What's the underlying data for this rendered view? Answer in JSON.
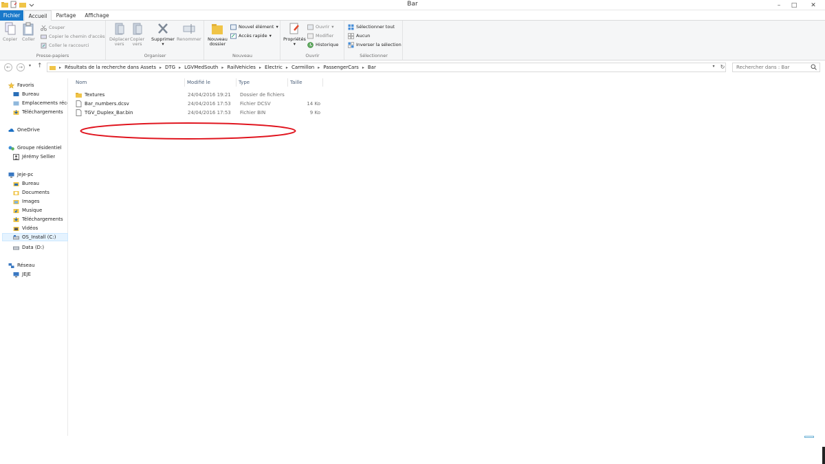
{
  "window": {
    "title": "Bar"
  },
  "tabs": [
    "Fichier",
    "Accueil",
    "Partage",
    "Affichage"
  ],
  "ribbon": {
    "clipboard": {
      "label": "Presse-papiers",
      "copy": "Copier",
      "paste": "Coller",
      "cut": "Couper",
      "copy_path": "Copier le chemin d'accès",
      "paste_shortcut": "Coller le raccourci"
    },
    "organize": {
      "label": "Organiser",
      "move_to_1": "Déplacer",
      "move_to_2": "vers",
      "copy_to_1": "Copier",
      "copy_to_2": "vers",
      "delete": "Supprimer",
      "rename": "Renommer"
    },
    "new": {
      "label": "Nouveau",
      "new_folder_1": "Nouveau",
      "new_folder_2": "dossier",
      "new_item": "Nouvel élément",
      "quick_access": "Accès rapide"
    },
    "open": {
      "label": "Ouvrir",
      "properties": "Propriétés",
      "open": "Ouvrir",
      "modify": "Modifier",
      "history": "Historique"
    },
    "select": {
      "label": "Sélectionner",
      "select_all": "Sélectionner tout",
      "select_none": "Aucun",
      "invert": "Inverser la sélection"
    }
  },
  "address": {
    "crumbs": [
      "Résultats de la recherche dans Assets",
      "DTG",
      "LGVMedSouth",
      "RailVehicles",
      "Electric",
      "Carmillon",
      "PassengerCars",
      "Bar"
    ],
    "search_placeholder": "Rechercher dans : Bar"
  },
  "navpane": {
    "favorites": "Favoris",
    "fav_items": [
      "Bureau",
      "Emplacements récents",
      "Téléchargements"
    ],
    "onedrive": "OneDrive",
    "homegroup": "Groupe résidentiel",
    "homegroup_user": "Jérémy Sellier",
    "pc": "Jeje-pc",
    "pc_items": [
      "Bureau",
      "Documents",
      "Images",
      "Musique",
      "Téléchargements",
      "Vidéos",
      "OS_Install (C:)",
      "Data (D:)"
    ],
    "network": "Réseau",
    "network_items": [
      "JEJE"
    ]
  },
  "columns": {
    "name": "Nom",
    "modified": "Modifié le",
    "type": "Type",
    "size": "Taille"
  },
  "files": [
    {
      "name": "Textures",
      "modified": "24/04/2016 19:21",
      "type": "Dossier de fichiers",
      "size": ""
    },
    {
      "name": "Bar_numbers.dcsv",
      "modified": "24/04/2016 17:53",
      "type": "Fichier DCSV",
      "size": "14 Ko"
    },
    {
      "name": "TGV_Duplex_Bar.bin",
      "modified": "24/04/2016 17:53",
      "type": "Fichier BIN",
      "size": "9 Ko"
    }
  ],
  "colors": {
    "accent": "#1979ca",
    "annotation": "#e0141e",
    "folder": "#f0c447"
  }
}
